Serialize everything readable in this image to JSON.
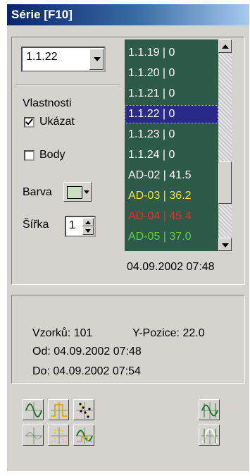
{
  "window": {
    "title": "Série [F10]"
  },
  "series_select": {
    "value": "1.1.22"
  },
  "properties": {
    "heading": "Vlastnosti",
    "show_label": "Ukázat",
    "show_checked": true,
    "points_label": "Body",
    "points_checked": false,
    "color_label": "Barva",
    "color_value": "#c8e0c0",
    "width_label": "Šířka",
    "width_value": "1"
  },
  "series_list": {
    "items": [
      {
        "text": "1.1.19 | 0",
        "color": "#ffffff",
        "selected": false
      },
      {
        "text": "1.1.20 | 0",
        "color": "#ffffff",
        "selected": false
      },
      {
        "text": "1.1.21 | 0",
        "color": "#ffffff",
        "selected": false
      },
      {
        "text": "1.1.22 | 0",
        "color": "#ffffff",
        "selected": true
      },
      {
        "text": "1.1.23 | 0",
        "color": "#ffffff",
        "selected": false
      },
      {
        "text": "1.1.24 | 0",
        "color": "#ffffff",
        "selected": false
      },
      {
        "text": "AD-02 | 41.5",
        "color": "#ffffff",
        "selected": false
      },
      {
        "text": "AD-03 | 36.2",
        "color": "#f4e040",
        "selected": false
      },
      {
        "text": "AD-04 | 45.4",
        "color": "#e03030",
        "selected": false
      },
      {
        "text": "AD-05 | 37.0",
        "color": "#60d040",
        "selected": false
      }
    ]
  },
  "list_timestamp": "04.09.2002 07:48",
  "info": {
    "samples": "Vzorků: 101",
    "y_position": "Y-Pozice: 22.0",
    "from": "Od: 04.09.2002 07:48",
    "to": "Do: 04.09.2002 07:54"
  },
  "colors": {
    "list_bg": "#2e5a4a",
    "selected_bg": "#2a2a8a",
    "accent_yellow": "#f0d000",
    "accent_green": "#2a8a3a"
  }
}
